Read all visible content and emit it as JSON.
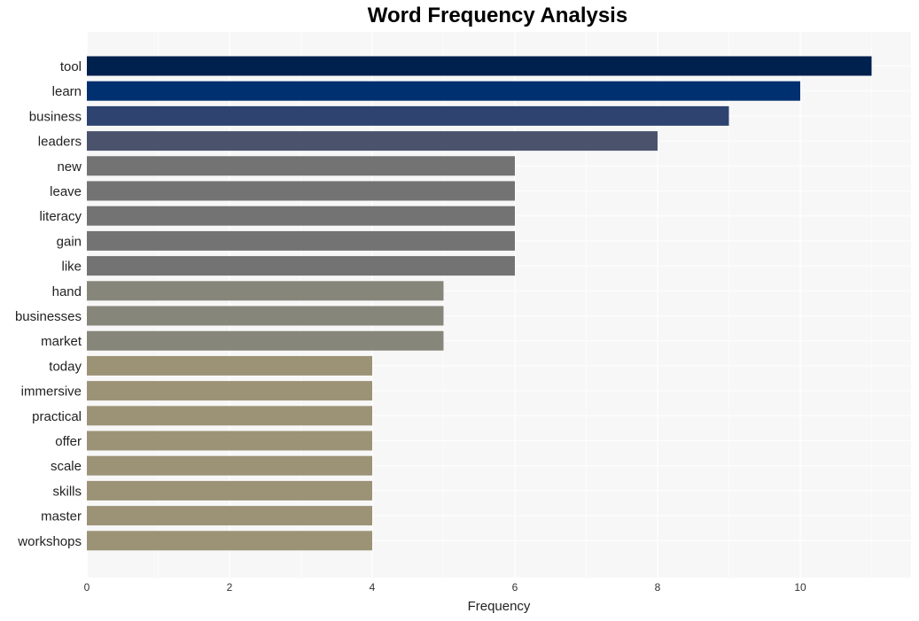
{
  "chart_data": {
    "type": "bar",
    "orientation": "horizontal",
    "title": "Word Frequency Analysis",
    "xlabel": "Frequency",
    "ylabel": "",
    "xlim": [
      0,
      11.55
    ],
    "xticks": [
      0,
      2,
      4,
      6,
      8,
      10
    ],
    "grid": true,
    "categories": [
      "tool",
      "learn",
      "business",
      "leaders",
      "new",
      "leave",
      "literacy",
      "gain",
      "like",
      "hand",
      "businesses",
      "market",
      "today",
      "immersive",
      "practical",
      "offer",
      "scale",
      "skills",
      "master",
      "workshops"
    ],
    "values": [
      11,
      10,
      9,
      8,
      6,
      6,
      6,
      6,
      6,
      5,
      5,
      5,
      4,
      4,
      4,
      4,
      4,
      4,
      4,
      4
    ],
    "colors": [
      "#00204e",
      "#00306f",
      "#2e4370",
      "#4a536b",
      "#737373",
      "#737373",
      "#737373",
      "#737373",
      "#737373",
      "#87867a",
      "#87867a",
      "#87867a",
      "#9c9377",
      "#9c9377",
      "#9c9377",
      "#9c9377",
      "#9c9377",
      "#9c9377",
      "#9c9377",
      "#9c9377"
    ],
    "panel_background": "#f7f7f7"
  }
}
